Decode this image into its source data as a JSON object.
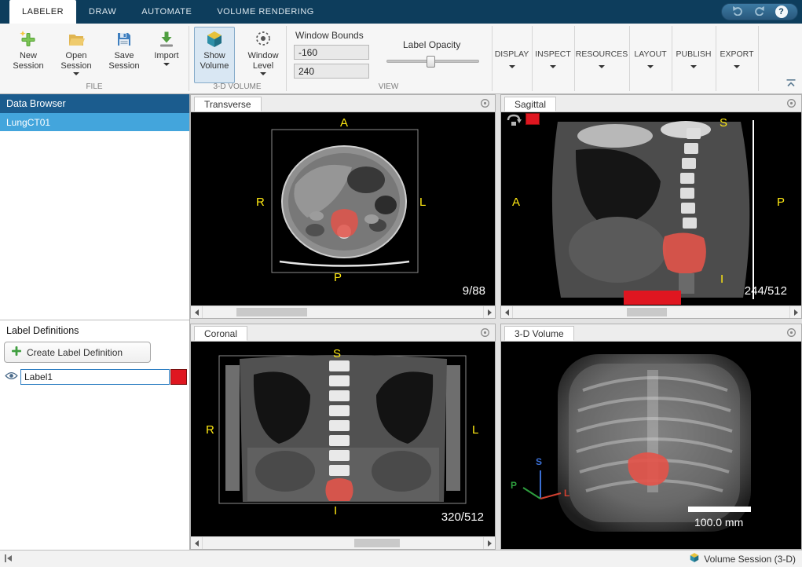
{
  "colors": {
    "label_red": "#df1620",
    "overlay_red": "#e2544a",
    "orientation_yellow": "#ffe912",
    "selection_blue": "#43a5dc",
    "header_blue": "#1b5c8e",
    "axis_s_blue": "#3b6fd4",
    "axis_p_green": "#2e9e3e",
    "axis_l_red": "#d04030"
  },
  "tab_bar": {
    "tabs": [
      {
        "label": "LABELER"
      },
      {
        "label": "DRAW"
      },
      {
        "label": "AUTOMATE"
      },
      {
        "label": "VOLUME RENDERING"
      }
    ]
  },
  "window_controls": {
    "help": "?"
  },
  "toolbar": {
    "file_section_label": "FILE",
    "new_session": "New Session",
    "open_session": "Open Session",
    "save_session": "Save Session",
    "import": "Import",
    "volume_section_label": "3-D VOLUME",
    "show_volume": "Show Volume",
    "window_level": "Window Level",
    "view_section_label": "VIEW",
    "window_bounds_label": "Window Bounds",
    "window_min": "-160",
    "window_max": "240",
    "label_opacity_label": "Label Opacity",
    "collapsed_groups": [
      {
        "label": "DISPLAY"
      },
      {
        "label": "INSPECT"
      },
      {
        "label": "RESOURCES"
      },
      {
        "label": "LAYOUT"
      },
      {
        "label": "PUBLISH"
      },
      {
        "label": "EXPORT"
      }
    ]
  },
  "data_browser": {
    "title": "Data Browser",
    "items": [
      {
        "label": "LungCT01"
      }
    ]
  },
  "label_definitions": {
    "title": "Label Definitions",
    "create_button": "Create Label Definition",
    "labels": [
      {
        "name": "Label1",
        "color": "#df1620"
      }
    ]
  },
  "viewports": {
    "transverse": {
      "tab": "Transverse",
      "top": "A",
      "left": "R",
      "right": "L",
      "bottom": "P",
      "slice": "9/88"
    },
    "sagittal": {
      "tab": "Sagittal",
      "top": "S",
      "left": "A",
      "right": "P",
      "bottom": "I",
      "slice": "244/512"
    },
    "coronal": {
      "tab": "Coronal",
      "top": "S",
      "left": "R",
      "right": "L",
      "bottom": "I",
      "slice": "320/512"
    },
    "volume3d": {
      "tab": "3-D Volume",
      "scale_label": "100.0 mm",
      "axis_s": "S",
      "axis_p": "P",
      "axis_l": "L"
    }
  },
  "status_bar": {
    "session_label": "Volume Session (3-D)"
  }
}
